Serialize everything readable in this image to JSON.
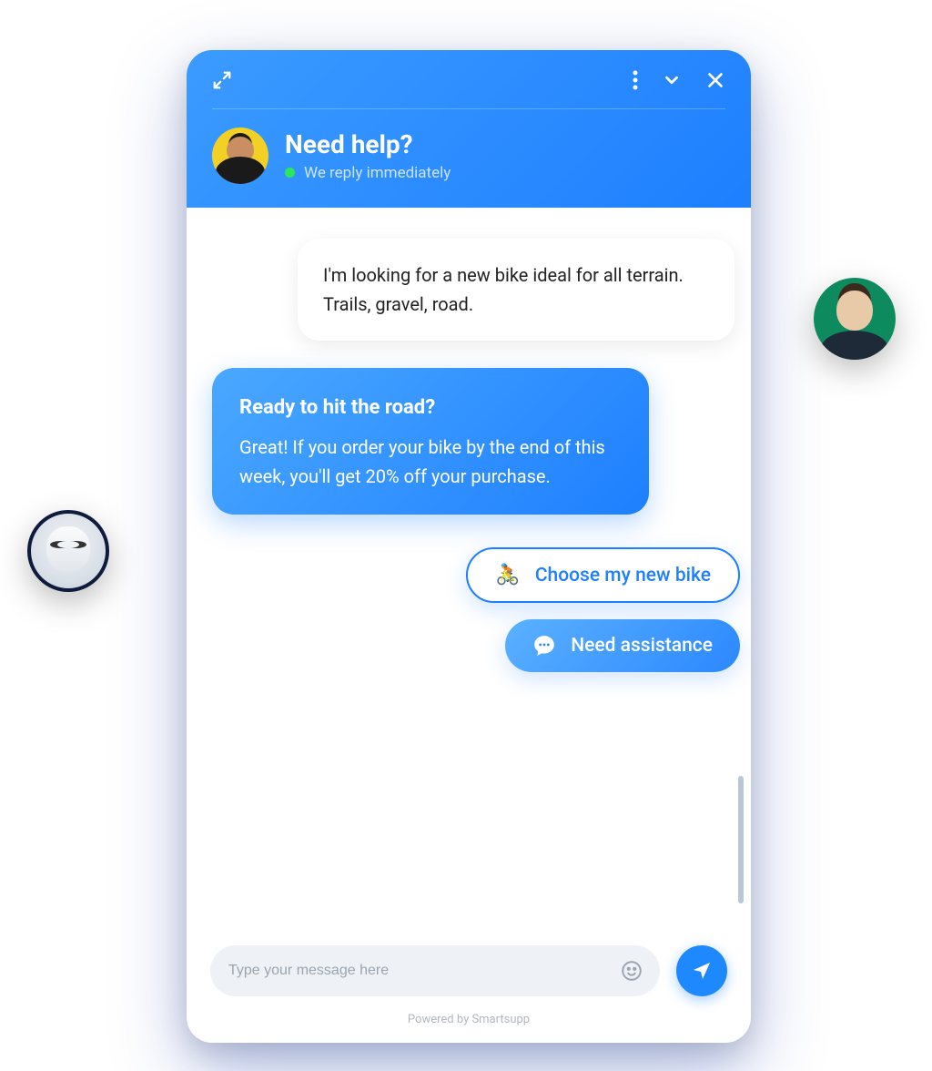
{
  "header": {
    "title": "Need help?",
    "status_text": "We reply immediately"
  },
  "messages": {
    "user_msg": "I'm looking for a new bike ideal for all terrain. Trails, gravel, road.",
    "bot_title": "Ready to hit the road?",
    "bot_body": "Great! If you order your bike by the end of this week, you'll get 20% off your purchase."
  },
  "quick_replies": {
    "choose_bike": {
      "emoji": "🚴",
      "label": "Choose my new bike"
    },
    "need_assistance": {
      "emoji": "💬",
      "label": "Need assistance"
    }
  },
  "input": {
    "placeholder": "Type your message here"
  },
  "footer": {
    "powered_by": "Powered by Smartsupp"
  },
  "icons": {
    "expand": "expand-icon",
    "more": "more-icon",
    "chevron_down": "chevron-down-icon",
    "close": "close-icon",
    "emoji": "emoji-icon",
    "send": "send-icon"
  },
  "colors": {
    "primary_gradient_start": "#4aa8ff",
    "primary_gradient_end": "#1e7fff",
    "status_green": "#2ae85a"
  }
}
